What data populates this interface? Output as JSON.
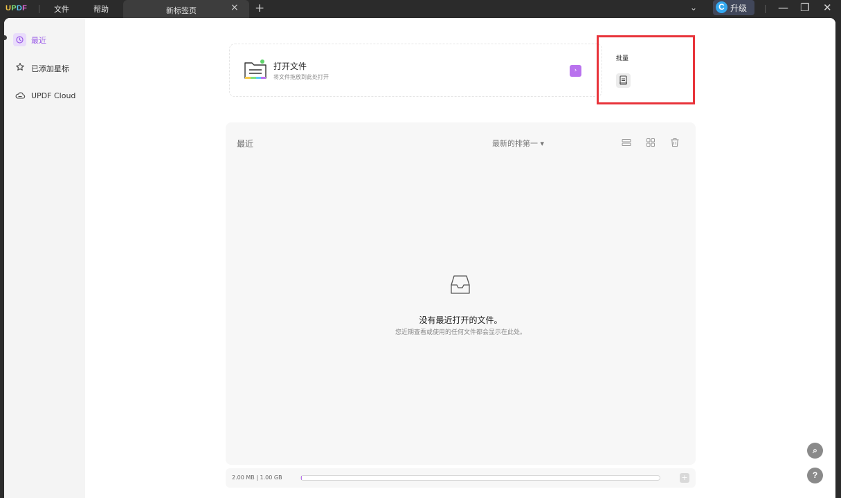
{
  "app": {
    "logo": {
      "p1": "U",
      "p2": "P",
      "p3": "D",
      "p4": "F"
    },
    "menu": [
      "文件",
      "帮助"
    ],
    "tab": {
      "title": "新标签页",
      "close": "×"
    },
    "new_tab": "+",
    "upgrade": {
      "icon_letter": "C",
      "label": "升级"
    },
    "window_controls": {
      "minimize": "—",
      "restore": "❐",
      "close": "✕",
      "dropdown": "⌄"
    }
  },
  "sidebar": {
    "items": [
      {
        "label": "最近",
        "icon": "clock-icon",
        "active": true
      },
      {
        "label": "已添加星标",
        "icon": "star-icon",
        "active": false
      },
      {
        "label": "UPDF Cloud",
        "icon": "cloud-icon",
        "active": false
      }
    ]
  },
  "open_card": {
    "title": "打开文件",
    "subtitle": "将文件拖放到此处打开",
    "arrow": "›"
  },
  "batch_card": {
    "title": "批量",
    "icon": "batch-document-icon"
  },
  "recent": {
    "title": "最近",
    "sort_label": "最新的排第一",
    "sort_caret": "▾",
    "icons": [
      "list-view-icon",
      "grid-view-icon",
      "trash-icon"
    ],
    "empty_title": "没有最近打开的文件。",
    "empty_subtitle": "您近期查看或使用的任何文件都会显示在此处。"
  },
  "storage": {
    "text": "2.00 MB | 1.00 GB",
    "used_fraction": 0.002,
    "add": "+"
  },
  "float_buttons": {
    "search": "⌕",
    "help": "?"
  },
  "colors": {
    "accent": "#9a5be8",
    "accent_button": "#b972ee",
    "highlight_box": "#e8333a",
    "upgrade_icon": "#34a8f0",
    "titlebar": "#2b2b2b"
  }
}
